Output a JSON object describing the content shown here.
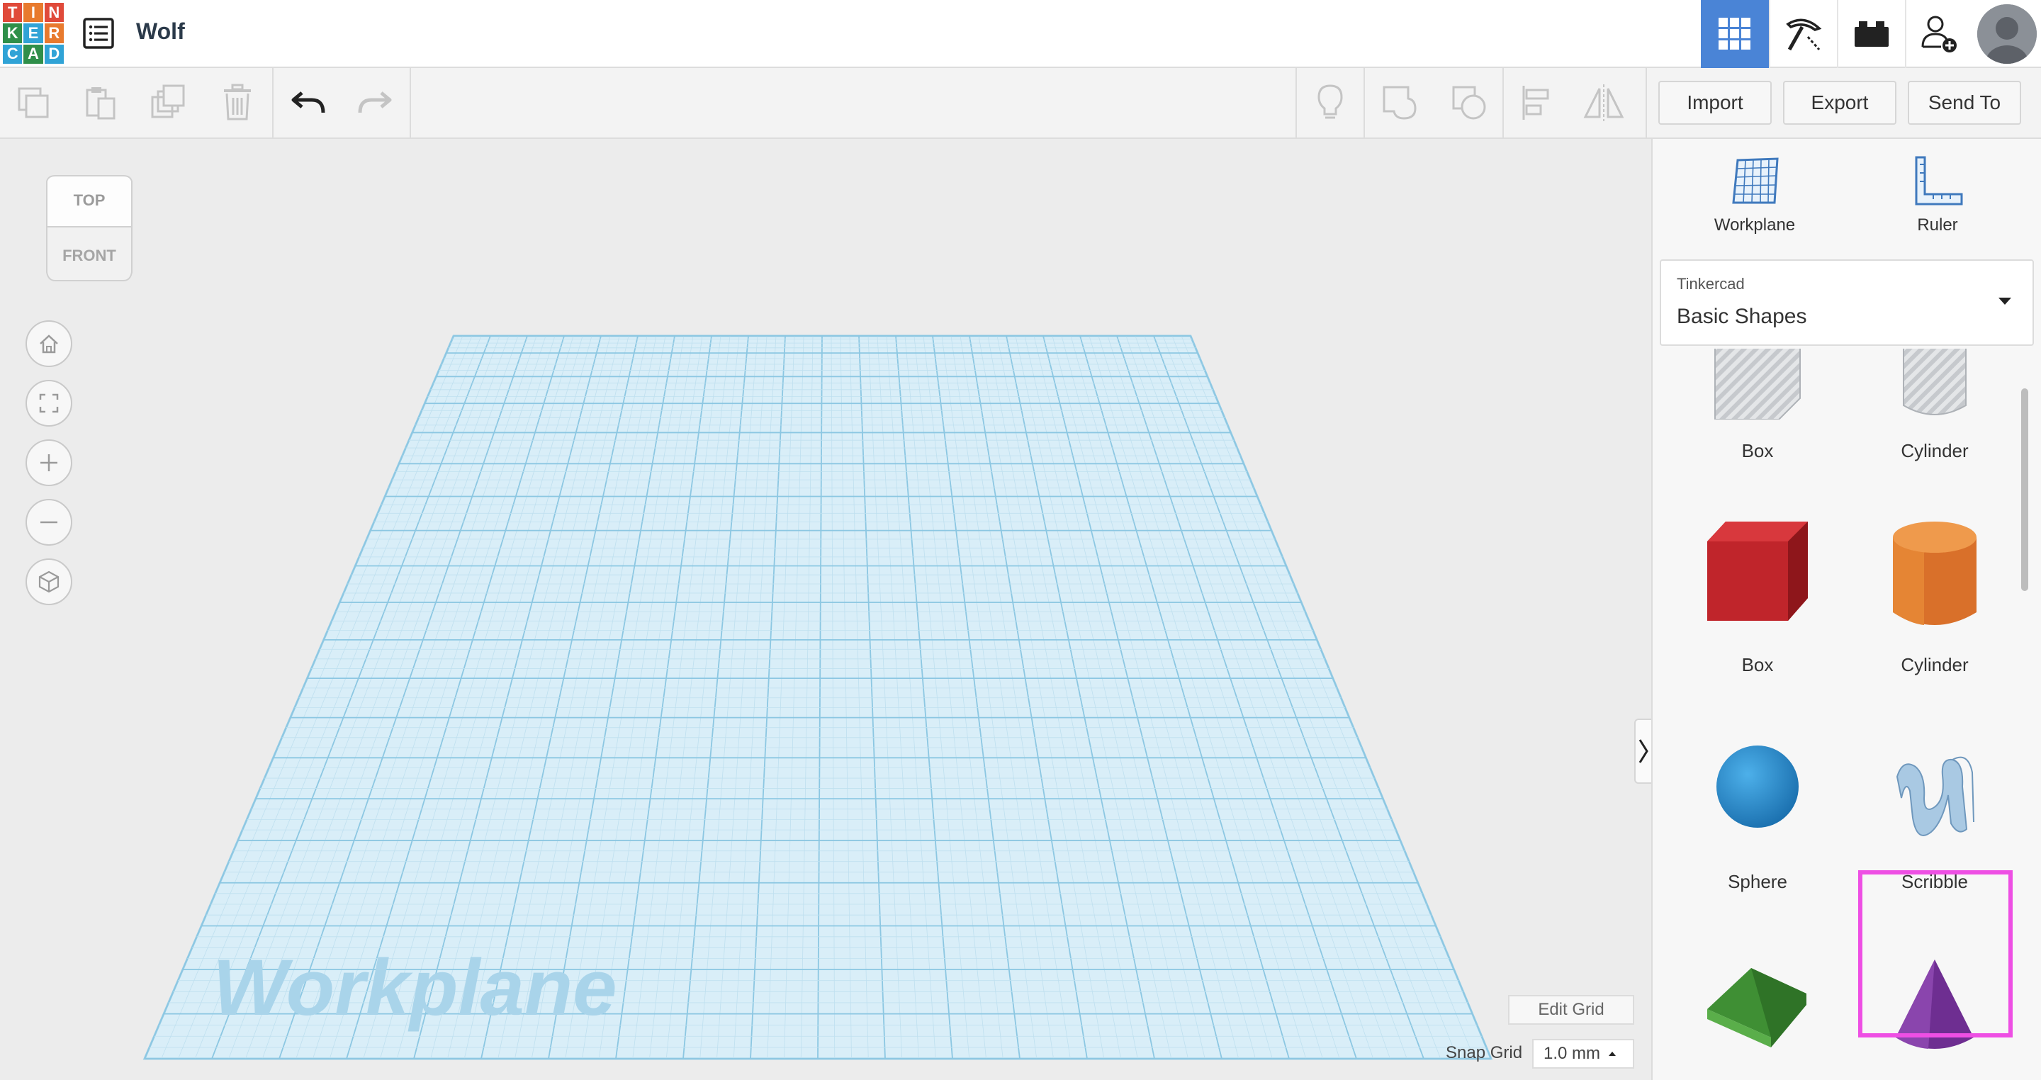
{
  "app": {
    "logo_letters": [
      "T",
      "I",
      "N",
      "K",
      "E",
      "R",
      "C",
      "A",
      "D"
    ],
    "logo_colors": [
      "#e04a3a",
      "#e04a3a",
      "#e04a3a",
      "#30a3d6",
      "#30a3d6",
      "#30a3d6",
      "#2f8f4a",
      "#2f8f4a",
      "#2f8f4a"
    ],
    "design_title": "Wolf",
    "accent": "#4a84d6"
  },
  "topbar_icons": [
    {
      "name": "3d-design-icon",
      "active": true
    },
    {
      "name": "codeblocks-pickaxe-icon",
      "active": false
    },
    {
      "name": "bricks-icon",
      "active": false
    },
    {
      "name": "add-user-icon",
      "active": false
    }
  ],
  "toolbar": {
    "import_label": "Import",
    "export_label": "Export",
    "send_to_label": "Send To"
  },
  "viewcube": {
    "top_label": "TOP",
    "front_label": "FRONT"
  },
  "canvas": {
    "workplane_watermark": "Workplane",
    "edit_grid_label": "Edit Grid",
    "snap_grid_label": "Snap Grid",
    "snap_grid_value": "1.0 mm"
  },
  "panel": {
    "workplane_label": "Workplane",
    "ruler_label": "Ruler",
    "library_source": "Tinkercad",
    "library_name": "Basic Shapes",
    "shapes": [
      {
        "label": "Box",
        "kind": "hole-box"
      },
      {
        "label": "Cylinder",
        "kind": "hole-cylinder"
      },
      {
        "label": "Box",
        "kind": "box",
        "color": "#c8262b"
      },
      {
        "label": "Cylinder",
        "kind": "cylinder",
        "color": "#e07a2a"
      },
      {
        "label": "Sphere",
        "kind": "sphere",
        "color": "#2a8fd1"
      },
      {
        "label": "Scribble",
        "kind": "scribble",
        "color": "#a9c9e3",
        "highlighted": true
      },
      {
        "label": "",
        "kind": "roof",
        "color": "#4ea53e"
      },
      {
        "label": "",
        "kind": "cone",
        "color": "#7a3a9c"
      }
    ],
    "highlight_color": "#ee4fe4"
  }
}
